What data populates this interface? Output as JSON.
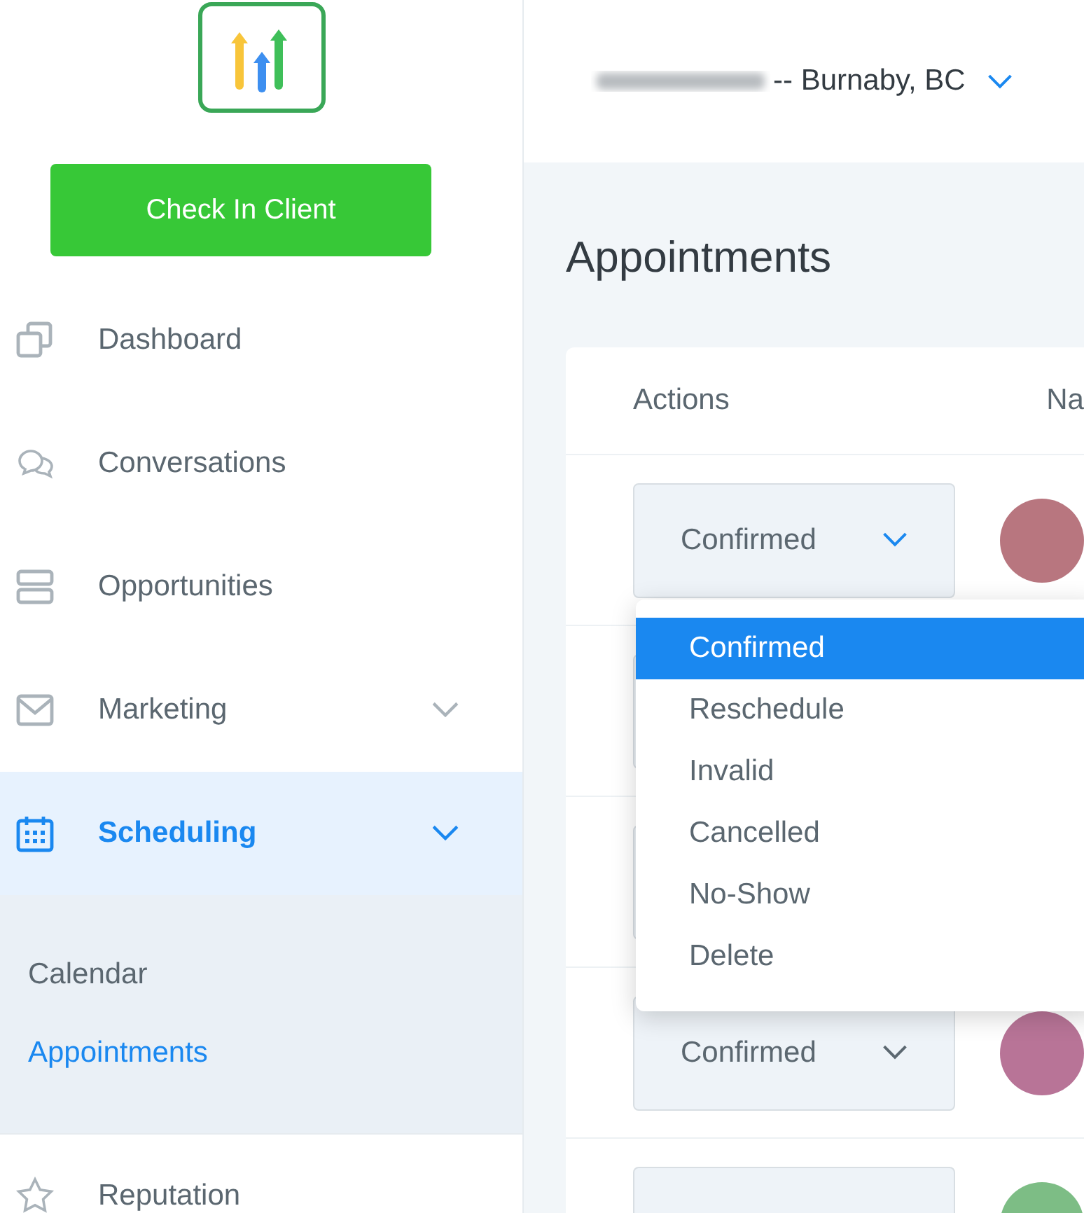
{
  "sidebar": {
    "check_in_button": "Check In Client",
    "items": [
      {
        "kind": "dashboard",
        "label": "Dashboard",
        "expandable": false,
        "selected": false
      },
      {
        "kind": "conversations",
        "label": "Conversations",
        "expandable": false,
        "selected": false
      },
      {
        "kind": "opportunities",
        "label": "Opportunities",
        "expandable": false,
        "selected": false
      },
      {
        "kind": "marketing",
        "label": "Marketing",
        "expandable": true,
        "selected": false
      },
      {
        "kind": "scheduling",
        "label": "Scheduling",
        "expandable": true,
        "selected": true,
        "children": [
          {
            "label": "Calendar",
            "selected": false
          },
          {
            "label": "Appointments",
            "selected": true
          }
        ]
      },
      {
        "kind": "reputation",
        "label": "Reputation",
        "expandable": false,
        "selected": false
      }
    ]
  },
  "header": {
    "location": "-- Burnaby, BC"
  },
  "page": {
    "title": "Appointments"
  },
  "table": {
    "columns": [
      "Actions",
      "Na"
    ],
    "rows": [
      {
        "status": "Confirmed",
        "color": "#b8767f"
      },
      {},
      {},
      {
        "status": "Confirmed",
        "color": "#b87497"
      },
      {
        "color": "#7dbd85"
      }
    ]
  },
  "dropdown": {
    "options": [
      {
        "label": "Confirmed",
        "selected": true
      },
      {
        "label": "Reschedule",
        "selected": false
      },
      {
        "label": "Invalid",
        "selected": false
      },
      {
        "label": "Cancelled",
        "selected": false
      },
      {
        "label": "No-Show",
        "selected": false
      },
      {
        "label": "Delete",
        "selected": false
      }
    ]
  }
}
